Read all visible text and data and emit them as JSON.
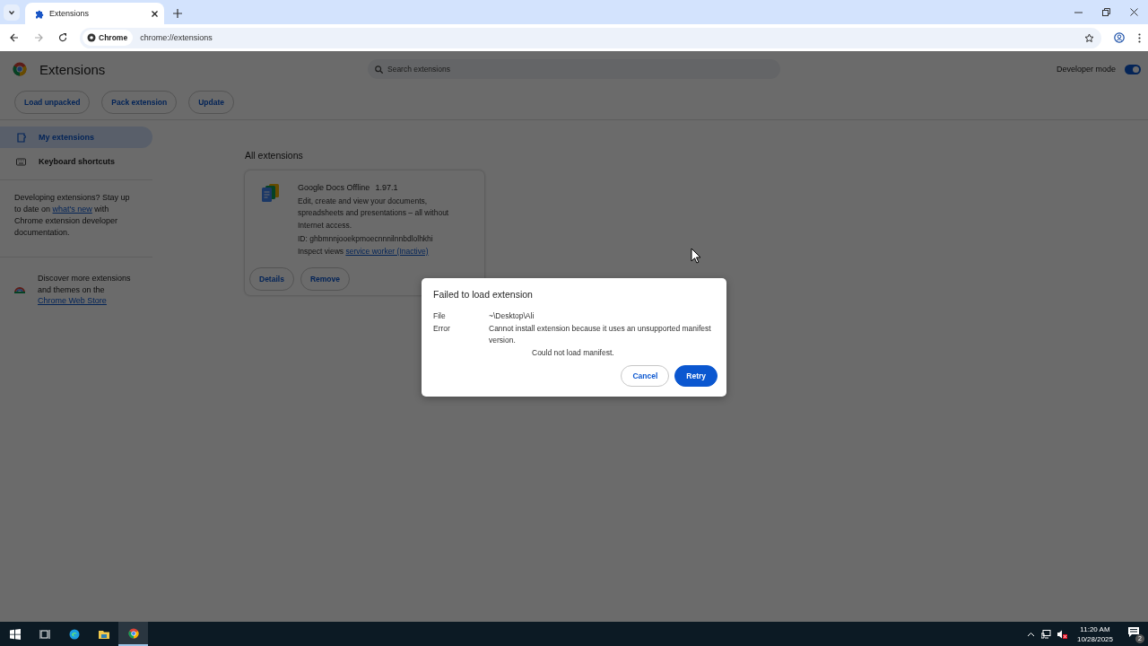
{
  "browser": {
    "tabs": [
      {
        "title": "Extensions",
        "selected": true
      }
    ],
    "address": {
      "chip": "Chrome",
      "url": "chrome://extensions"
    }
  },
  "page": {
    "title": "Extensions",
    "search": {
      "placeholder": "Search extensions"
    },
    "developer_mode": {
      "label": "Developer mode",
      "on": true
    },
    "actions": [
      "Load unpacked",
      "Pack extension",
      "Update"
    ],
    "sidebar": {
      "items": [
        {
          "label": "My extensions",
          "kind": "extensions",
          "selected": true
        },
        {
          "label": "Keyboard shortcuts",
          "kind": "keyboard",
          "selected": false
        }
      ],
      "promo": {
        "before": "Developing extensions? Stay up to date on ",
        "link": "what's new",
        "after": " with Chrome extension developer documentation."
      },
      "store": {
        "before": "Discover more extensions and themes on the ",
        "link": "Chrome Web Store"
      }
    },
    "section_title": "All extensions",
    "extensions": [
      {
        "name": "Google Docs Offline",
        "version": "1.97.1",
        "description": "Edit, create and view your documents, spreadsheets and presentations – all without Internet access.",
        "id": "ID: ghbmnnjooekpmoecnnnilnnbdlolhkhi",
        "inspect_label": "Inspect views",
        "inspect_link": "service worker (Inactive)",
        "buttons": [
          "Details",
          "Remove"
        ]
      }
    ]
  },
  "dialog": {
    "title": "Failed to load extension",
    "fields": [
      {
        "label": "File",
        "value": "~\\Desktop\\Ali"
      },
      {
        "label": "Error",
        "value": "Cannot install extension because it uses an unsupported manifest version."
      }
    ],
    "note": "Could not load manifest.",
    "buttons": [
      {
        "label": "Cancel",
        "kind": "secondary"
      },
      {
        "label": "Retry",
        "kind": "primary"
      }
    ]
  },
  "taskbar": {
    "apps": [
      {
        "kind": "start",
        "active": false
      },
      {
        "kind": "taskview",
        "active": false
      },
      {
        "kind": "edge",
        "active": false
      },
      {
        "kind": "files",
        "active": false
      },
      {
        "kind": "chrome",
        "active": true
      }
    ],
    "time": "11:20 AM",
    "date": "10/28/2025",
    "notifications": "2"
  }
}
